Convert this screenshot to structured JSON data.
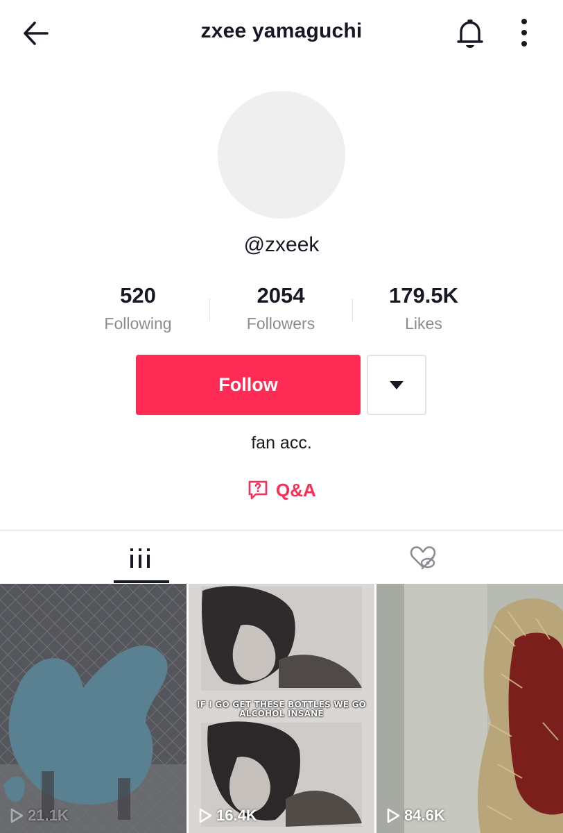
{
  "header": {
    "title": "zxee yamaguchi",
    "back_icon": "arrow-left-icon",
    "bell_icon": "bell-icon",
    "more_icon": "more-vertical-icon"
  },
  "profile": {
    "username": "@zxeek",
    "bio": "fan acc.",
    "qa_label": "Q&A",
    "qa_icon": "question-bubble-icon"
  },
  "stats": [
    {
      "value": "520",
      "label": "Following"
    },
    {
      "value": "2054",
      "label": "Followers"
    },
    {
      "value": "179.5K",
      "label": "Likes"
    }
  ],
  "actions": {
    "follow_label": "Follow",
    "dropdown_icon": "caret-down-icon"
  },
  "tabs": [
    {
      "icon": "grid-icon",
      "active": true
    },
    {
      "icon": "heart-hidden-icon",
      "active": false
    }
  ],
  "videos": [
    {
      "views": "21.1K"
    },
    {
      "views": "16.4K",
      "caption": "IF I GO GET THESE BOTTLES WE GO ALCOHOL INSANE"
    },
    {
      "views": "84.6K"
    }
  ],
  "colors": {
    "accent": "#fe2c55",
    "text": "#161823",
    "muted": "#8a8b91"
  }
}
